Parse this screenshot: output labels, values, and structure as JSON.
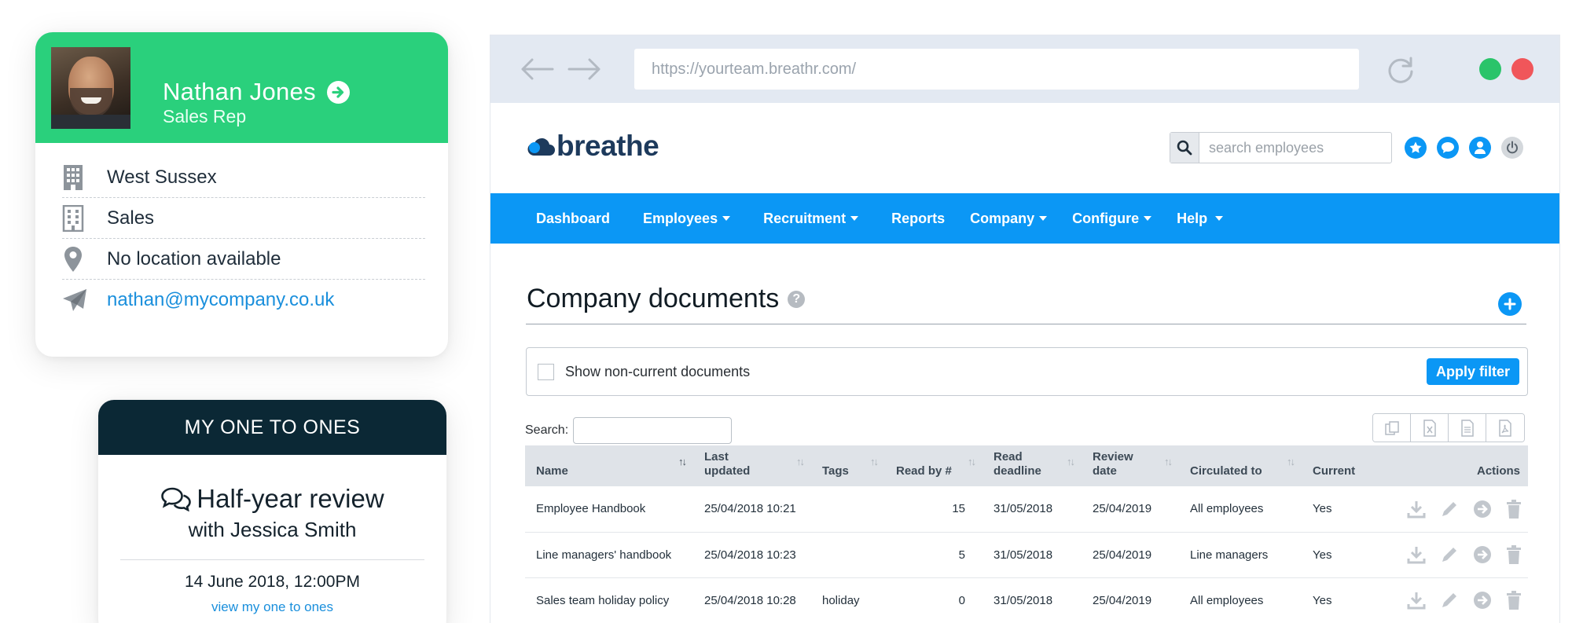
{
  "profile": {
    "name": "Nathan Jones",
    "role": "Sales Rep",
    "rows": [
      {
        "icon": "building-icon",
        "text": "West Sussex"
      },
      {
        "icon": "office-icon",
        "text": "Sales"
      },
      {
        "icon": "map-pin-icon",
        "text": "No location available"
      },
      {
        "icon": "paper-plane-icon",
        "text": "nathan@mycompany.co.uk"
      }
    ]
  },
  "one_to_ones": {
    "header": "MY ONE TO ONES",
    "title": "Half-year review",
    "with": "with Jessica Smith",
    "date": "14 June 2018, 12:00PM",
    "link": "view my one to ones"
  },
  "browser": {
    "url": "https://yourteam.breathr.com/"
  },
  "app": {
    "logo": "breathe",
    "search_placeholder": "search employees",
    "nav": [
      {
        "label": "Dashboard",
        "dropdown": false
      },
      {
        "label": "Employees",
        "dropdown": true
      },
      {
        "label": "Recruitment",
        "dropdown": true
      },
      {
        "label": "Reports",
        "dropdown": false
      },
      {
        "label": "Company",
        "dropdown": true
      },
      {
        "label": "Configure",
        "dropdown": true
      },
      {
        "label": "Help",
        "dropdown": true
      }
    ],
    "colors": {
      "nav": "#0b97f5",
      "accent_green": "#2ad07c",
      "dark_header": "#0b2835"
    }
  },
  "documents": {
    "title": "Company documents",
    "filter_label": "Show non-current documents",
    "apply_label": "Apply filter",
    "search_label": "Search:",
    "columns": [
      "Name",
      "Last updated",
      "Tags",
      "Read by #",
      "Read deadline",
      "Review date",
      "Circulated to",
      "Current",
      "Actions"
    ],
    "rows": [
      {
        "name": "Employee Handbook",
        "last_updated": "25/04/2018 10:21",
        "tags": "",
        "read_by": "15",
        "read_deadline": "31/05/2018",
        "review_date": "25/04/2019",
        "circulated_to": "All employees",
        "current": "Yes"
      },
      {
        "name": "Line managers' handbook",
        "last_updated": "25/04/2018 10:23",
        "tags": "",
        "read_by": "5",
        "read_deadline": "31/05/2018",
        "review_date": "25/04/2019",
        "circulated_to": "Line managers",
        "current": "Yes"
      },
      {
        "name": "Sales team holiday policy",
        "last_updated": "25/04/2018 10:28",
        "tags": "holiday",
        "read_by": "0",
        "read_deadline": "31/05/2018",
        "review_date": "25/04/2019",
        "circulated_to": "All employees",
        "current": "Yes"
      }
    ]
  }
}
